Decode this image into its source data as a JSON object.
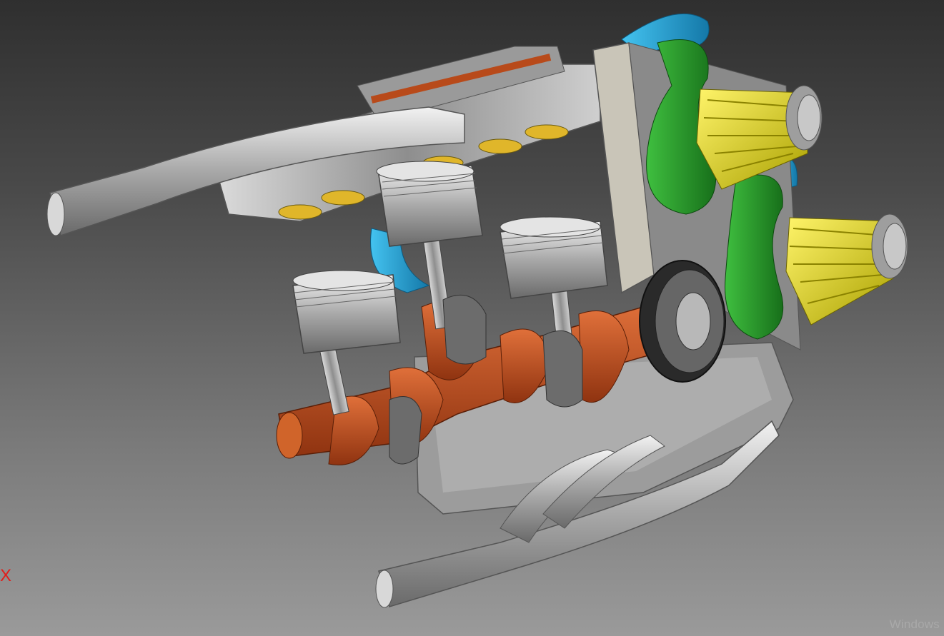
{
  "viewport": {
    "axis_indicator": "X",
    "axis_indicator_color": "#e0201c",
    "background_top": "#2f2f2f",
    "background_bottom": "#9a9a9a"
  },
  "model": {
    "part_colors": {
      "crankshaft": "#c4521e",
      "pistons": "#bdbdbd",
      "intake_runners": "#2aa12e",
      "coolant_hoses": "#1e9fd6",
      "air_filters": "#e8e02a",
      "valves": "#e0b62a",
      "exhaust_pipes": "#cfcfcf"
    }
  },
  "watermark": "Windows"
}
